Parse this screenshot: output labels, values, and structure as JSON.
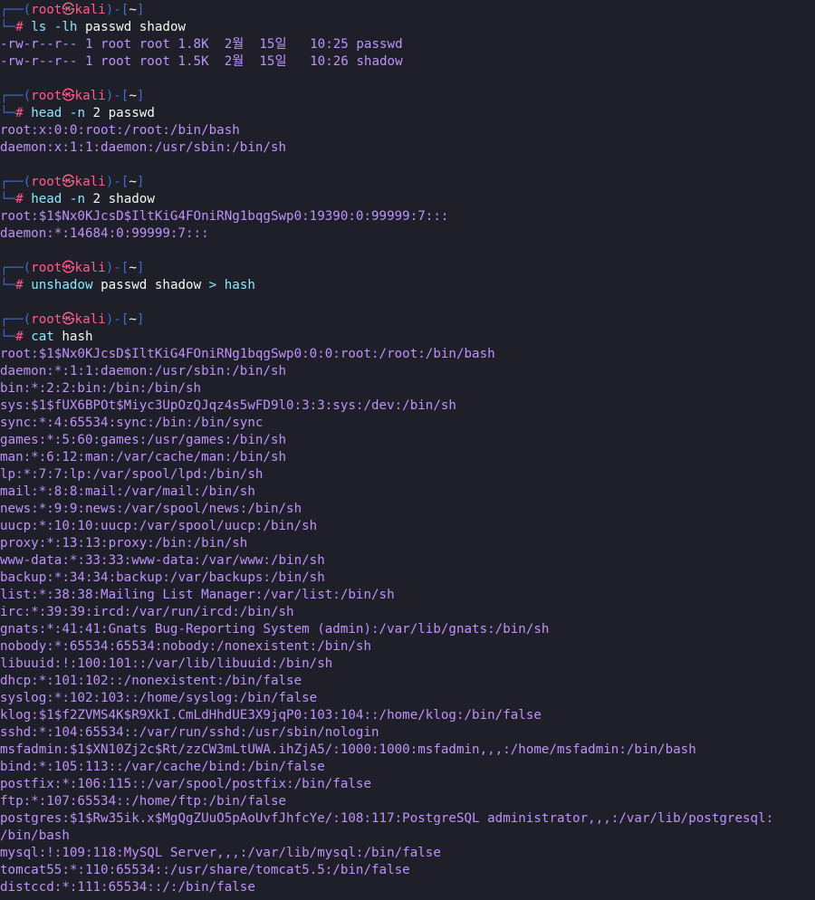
{
  "prompt": {
    "user": "root",
    "at_symbol": "㉿",
    "host": "kali",
    "dir": "~",
    "symbol": "#"
  },
  "blocks": [
    {
      "command": {
        "name": "ls",
        "opts": "-lh",
        "args": "passwd shadow"
      },
      "output": [
        "-rw-r--r-- 1 root root 1.8K  2월  15일   10:25 passwd",
        "-rw-r--r-- 1 root root 1.5K  2월  15일   10:26 shadow"
      ]
    },
    {
      "command": {
        "name": "head",
        "opts": "-n",
        "args": "2 passwd"
      },
      "output": [
        "root:x:0:0:root:/root:/bin/bash",
        "daemon:x:1:1:daemon:/usr/sbin:/bin/sh"
      ]
    },
    {
      "command": {
        "name": "head",
        "opts": "-n",
        "args": "2 shadow"
      },
      "output": [
        "root:$1$Nx0KJcsD$IltKiG4FOniRNg1bqgSwp0:19390:0:99999:7:::",
        "daemon:*:14684:0:99999:7:::"
      ]
    },
    {
      "command": {
        "name": "unshadow",
        "opts": "",
        "args": "passwd shadow",
        "redir": ">",
        "redir_target": "hash"
      },
      "output": []
    },
    {
      "command": {
        "name": "cat",
        "opts": "",
        "args": "hash"
      },
      "output": [
        "root:$1$Nx0KJcsD$IltKiG4FOniRNg1bqgSwp0:0:0:root:/root:/bin/bash",
        "daemon:*:1:1:daemon:/usr/sbin:/bin/sh",
        "bin:*:2:2:bin:/bin:/bin/sh",
        "sys:$1$fUX6BPOt$Miyc3UpOzQJqz4s5wFD9l0:3:3:sys:/dev:/bin/sh",
        "sync:*:4:65534:sync:/bin:/bin/sync",
        "games:*:5:60:games:/usr/games:/bin/sh",
        "man:*:6:12:man:/var/cache/man:/bin/sh",
        "lp:*:7:7:lp:/var/spool/lpd:/bin/sh",
        "mail:*:8:8:mail:/var/mail:/bin/sh",
        "news:*:9:9:news:/var/spool/news:/bin/sh",
        "uucp:*:10:10:uucp:/var/spool/uucp:/bin/sh",
        "proxy:*:13:13:proxy:/bin:/bin/sh",
        "www-data:*:33:33:www-data:/var/www:/bin/sh",
        "backup:*:34:34:backup:/var/backups:/bin/sh",
        "list:*:38:38:Mailing List Manager:/var/list:/bin/sh",
        "irc:*:39:39:ircd:/var/run/ircd:/bin/sh",
        "gnats:*:41:41:Gnats Bug-Reporting System (admin):/var/lib/gnats:/bin/sh",
        "nobody:*:65534:65534:nobody:/nonexistent:/bin/sh",
        "libuuid:!:100:101::/var/lib/libuuid:/bin/sh",
        "dhcp:*:101:102::/nonexistent:/bin/false",
        "syslog:*:102:103::/home/syslog:/bin/false",
        "klog:$1$f2ZVMS4K$R9XkI.CmLdHhdUE3X9jqP0:103:104::/home/klog:/bin/false",
        "sshd:*:104:65534::/var/run/sshd:/usr/sbin/nologin",
        "msfadmin:$1$XN10Zj2c$Rt/zzCW3mLtUWA.ihZjA5/:1000:1000:msfadmin,,,:/home/msfadmin:/bin/bash",
        "bind:*:105:113::/var/cache/bind:/bin/false",
        "postfix:*:106:115::/var/spool/postfix:/bin/false",
        "ftp:*:107:65534::/home/ftp:/bin/false",
        "postgres:$1$Rw35ik.x$MgQgZUuO5pAoUvfJhfcYe/:108:117:PostgreSQL administrator,,,:/var/lib/postgresql:",
        "/bin/bash",
        "mysql:!:109:118:MySQL Server,,,:/var/lib/mysql:/bin/false",
        "tomcat55:*:110:65534::/usr/share/tomcat5.5:/bin/false",
        "distccd:*:111:65534::/:/bin/false"
      ]
    }
  ]
}
